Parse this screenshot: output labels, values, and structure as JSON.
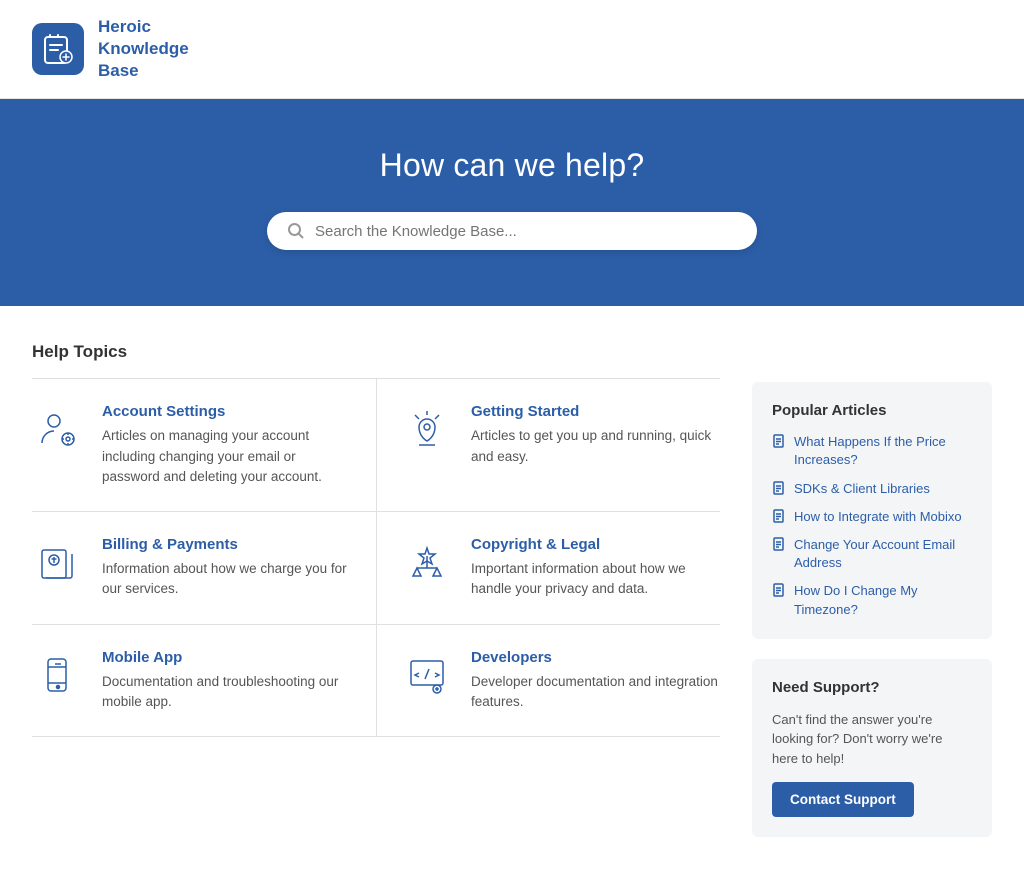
{
  "header": {
    "logo_alt": "Heroic Knowledge Base Logo",
    "title_line1": "Heroic",
    "title_line2": "Knowledge",
    "title_line3": "Base"
  },
  "hero": {
    "title": "How can we help?",
    "search_placeholder": "Search the Knowledge Base..."
  },
  "help_topics": {
    "section_title": "Help Topics",
    "topics": [
      {
        "id": "account-settings",
        "title": "Account Settings",
        "description": "Articles on managing your account including changing your email or password and deleting your account.",
        "icon": "user-settings"
      },
      {
        "id": "getting-started",
        "title": "Getting Started",
        "description": "Articles to get you up and running, quick and easy.",
        "icon": "rocket"
      },
      {
        "id": "billing-payments",
        "title": "Billing & Payments",
        "description": "Information about how we charge you for our services.",
        "icon": "billing"
      },
      {
        "id": "copyright-legal",
        "title": "Copyright & Legal",
        "description": "Important information about how we handle your privacy and data.",
        "icon": "legal"
      },
      {
        "id": "mobile-app",
        "title": "Mobile App",
        "description": "Documentation and troubleshooting our mobile app.",
        "icon": "mobile"
      },
      {
        "id": "developers",
        "title": "Developers",
        "description": "Developer documentation and integration features.",
        "icon": "code"
      }
    ]
  },
  "popular_articles": {
    "title": "Popular Articles",
    "articles": [
      "What Happens If the Price Increases?",
      "SDKs & Client Libraries",
      "How to Integrate with Mobixo",
      "Change Your Account Email Address",
      "How Do I Change My Timezone?"
    ]
  },
  "need_support": {
    "title": "Need Support?",
    "description": "Can't find the answer you're looking for? Don't worry we're here to help!",
    "button_label": "Contact Support"
  }
}
